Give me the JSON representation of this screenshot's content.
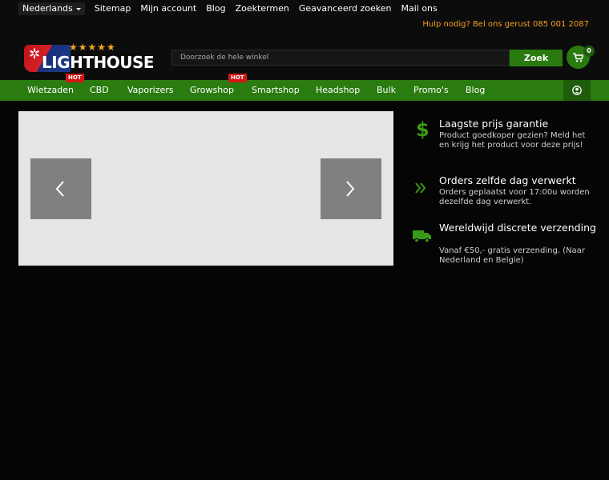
{
  "topbar": {
    "language": "Nederlands",
    "links": [
      "Sitemap",
      "Mijn account",
      "Blog",
      "Zoektermen",
      "Geavanceerd zoeken",
      "Mail ons"
    ],
    "helpline": "Hulp nodig? Bel ons gerust 085 001 2087"
  },
  "header": {
    "logo_text": "LIGHTHOUSE",
    "logo_stars": "★★★★★",
    "search_placeholder": "Doorzoek de hele winkel",
    "search_button": "Zoek",
    "cart_count": "0"
  },
  "nav": {
    "items": [
      {
        "label": "Wietzaden",
        "badge": "HOT"
      },
      {
        "label": "CBD",
        "badge": ""
      },
      {
        "label": "Vaporizers",
        "badge": ""
      },
      {
        "label": "Growshop",
        "badge": "HOT"
      },
      {
        "label": "Smartshop",
        "badge": ""
      },
      {
        "label": "Headshop",
        "badge": ""
      },
      {
        "label": "Bulk",
        "badge": ""
      },
      {
        "label": "Promo's",
        "badge": ""
      },
      {
        "label": "Blog",
        "badge": ""
      }
    ]
  },
  "usps": [
    {
      "icon": "dollar-icon",
      "title": "Laagste prijs garantie",
      "description": "Product goedkoper gezien? Meld het en krijg het product voor deze prijs!"
    },
    {
      "icon": "double-chevron-icon",
      "title": "Orders zelfde dag verwerkt",
      "description": "Orders geplaatst voor 17:00u worden dezelfde dag verwerkt."
    },
    {
      "icon": "truck-icon",
      "title": "Wereldwijd discrete verzending",
      "description": "Vanaf €50,- gratis verzending. (Naar Nederland en Belgie)"
    }
  ],
  "colors": {
    "brand_green": "#2b7c10",
    "accent_orange": "#f5a020",
    "hot_red": "#d01616"
  }
}
